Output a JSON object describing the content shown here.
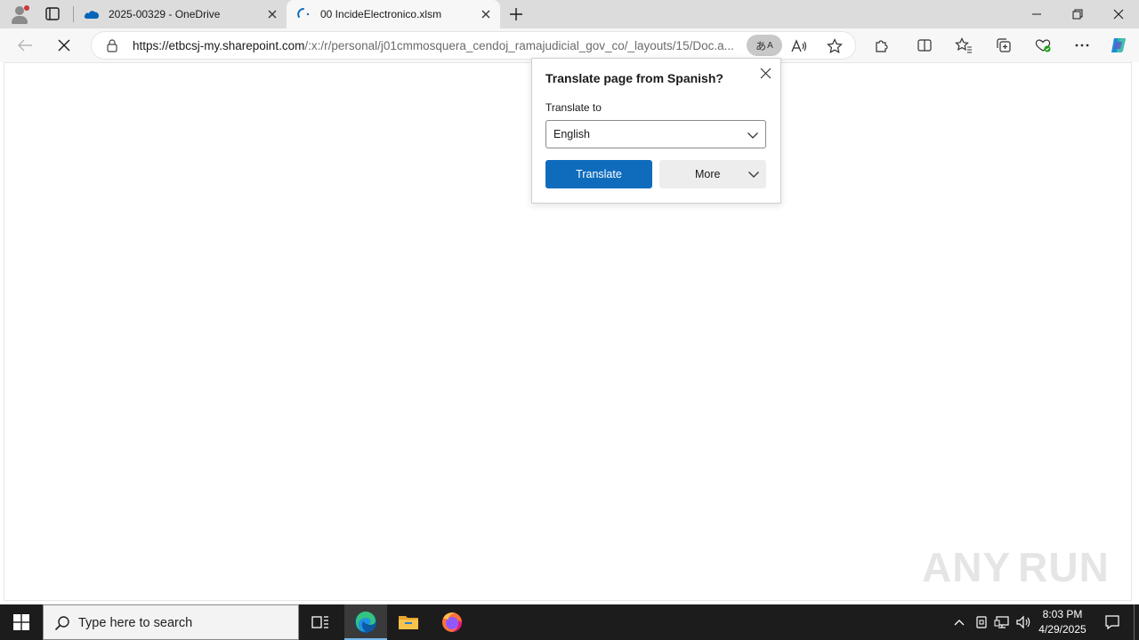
{
  "browser": {
    "tabs": [
      {
        "title": "2025-00329 - OneDrive",
        "icon": "onedrive-cloud-icon",
        "active": false
      },
      {
        "title": "00 IncideElectronico.xlsm",
        "icon": "loading-spinner-icon",
        "active": true
      }
    ],
    "address": {
      "url_host": "https://etbcsj-my.sharepoint.com",
      "url_path": "/:x:/r/personal/j01cmmosquera_cendoj_ramajudicial_gov_co/_layouts/15/Doc.a...",
      "translate_badge": "あ"
    },
    "window_controls": [
      "minimize",
      "restore",
      "close"
    ]
  },
  "translate_popup": {
    "title": "Translate page from Spanish?",
    "label": "Translate to",
    "selected_language": "English",
    "translate_button": "Translate",
    "more_button": "More"
  },
  "watermark": {
    "left": "ANY",
    "right": "RUN"
  },
  "taskbar": {
    "search_placeholder": "Type here to search",
    "apps": [
      "task-view",
      "edge",
      "file-explorer",
      "firefox"
    ],
    "clock_time": "8:03 PM",
    "clock_date": "4/29/2025"
  },
  "colors": {
    "accent": "#0f6cbd",
    "tabstrip": "#dcdcdc",
    "taskbar": "#1c1c1c"
  }
}
